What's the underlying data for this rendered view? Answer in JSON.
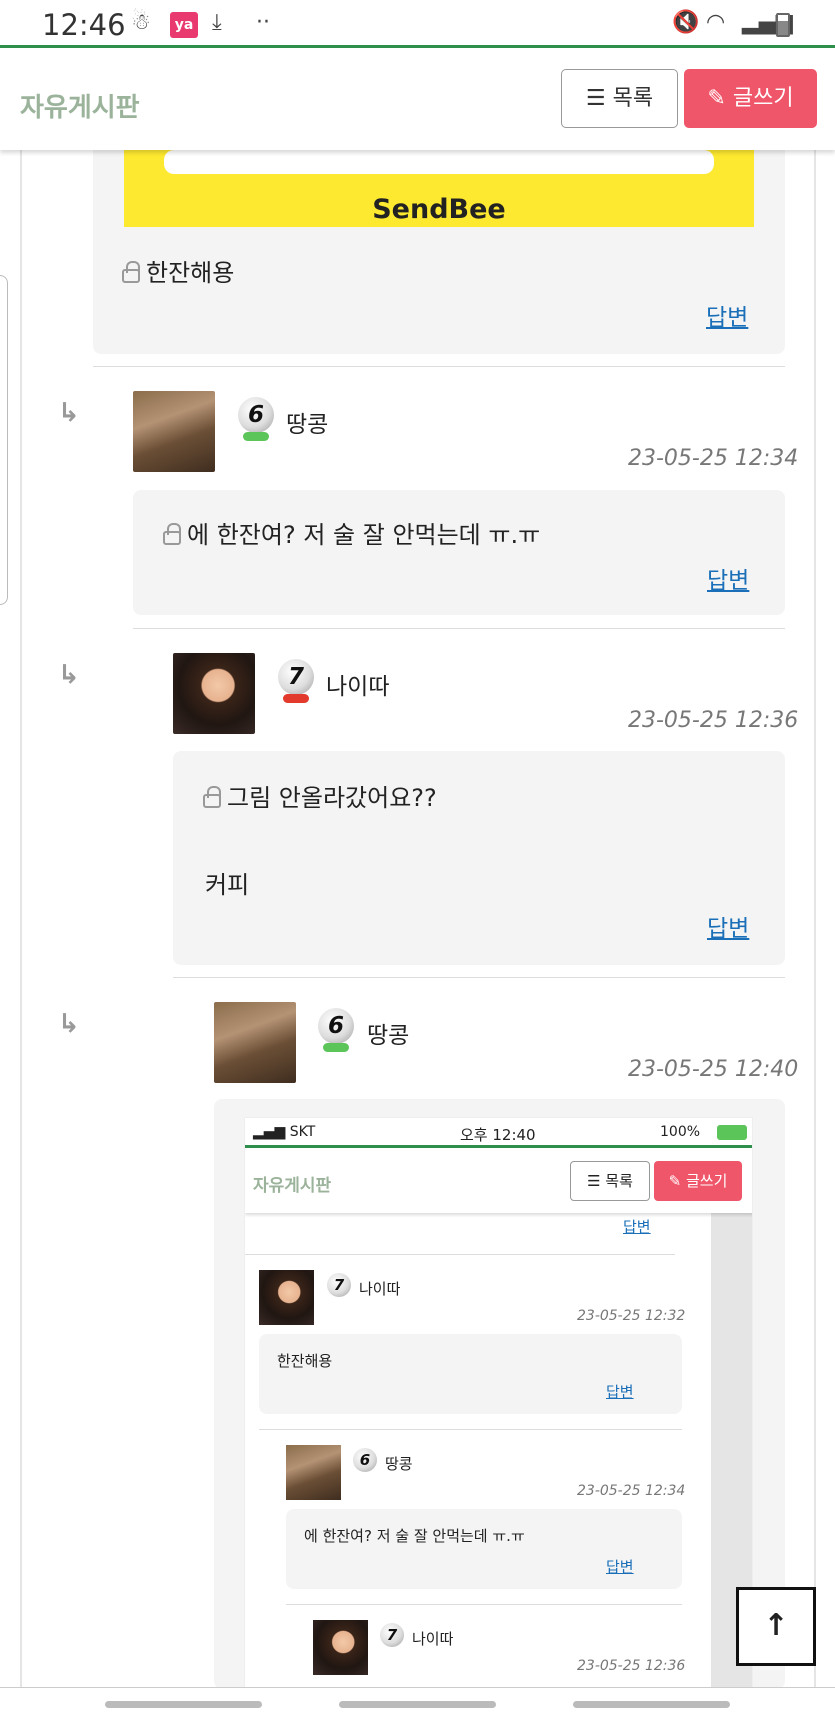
{
  "status_bar": {
    "time": "12:46",
    "app_badge": "ya",
    "dots": "··"
  },
  "header": {
    "title": "자유게시판",
    "list_button": "목록",
    "write_button": "글쓰기"
  },
  "sendbee": {
    "text": "SendBee"
  },
  "comments": [
    {
      "text": "한잔해용",
      "reply": "답변"
    },
    {
      "nickname": "땅콩",
      "level": "6",
      "date": "23-05-25 12:34",
      "text": "에 한잔여? 저 술 잘 안먹는데 ㅠ.ㅠ",
      "reply": "답변"
    },
    {
      "nickname": "나이따",
      "level": "7",
      "date": "23-05-25 12:36",
      "text": "그림 안올라갔어요??",
      "text2": "커피",
      "reply": "답변"
    },
    {
      "nickname": "땅콩",
      "level": "6",
      "date": "23-05-25 12:40"
    }
  ],
  "nested_screenshot": {
    "carrier": "SKT",
    "time": "오후 12:40",
    "battery": "100%",
    "title": "자유게시판",
    "list_button": "목록",
    "write_button": "글쓰기",
    "top_reply": "답변",
    "comments": [
      {
        "nickname": "나이따",
        "level": "7",
        "date": "23-05-25 12:32",
        "text": "한잔해용",
        "reply": "답변"
      },
      {
        "nickname": "땅콩",
        "level": "6",
        "date": "23-05-25 12:34",
        "text": "에 한잔여? 저 술 잘 안먹는데 ㅠ.ㅠ",
        "reply": "답변"
      },
      {
        "nickname": "나이따",
        "level": "7",
        "date": "23-05-25 12:36"
      }
    ]
  },
  "scroll_top": {
    "icon": "arrow-up-icon"
  }
}
